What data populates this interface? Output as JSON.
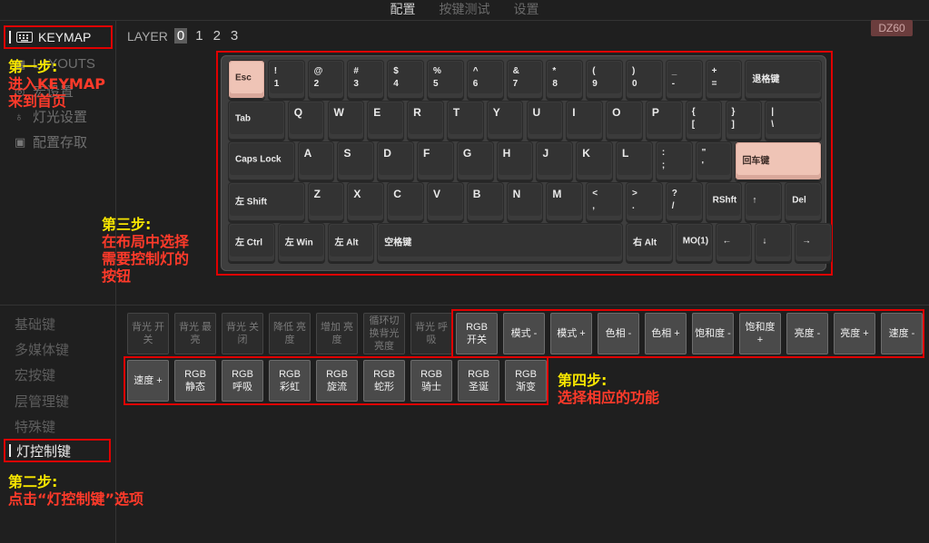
{
  "top_tabs": [
    "配置",
    "按键测试",
    "设置"
  ],
  "sidebar": {
    "keymap_label": "KEYMAP",
    "items": [
      {
        "label": "LAYOUTS",
        "icon": "layout-icon"
      },
      {
        "label": "宏设置",
        "icon": "macro-icon"
      },
      {
        "label": "灯光设置",
        "icon": "bulb-icon"
      },
      {
        "label": "配置存取",
        "icon": "save-icon"
      }
    ]
  },
  "layer": {
    "label": "LAYER",
    "values": [
      "0",
      "1",
      "2",
      "3"
    ],
    "selected": "0"
  },
  "badge": "DZ60",
  "annotations": {
    "step1_title": "第一步:",
    "step1_l1": "进入KEYMAP",
    "step1_l2": "来到首页",
    "step2_title": "第二步:",
    "step2_l1": "点击“灯控制键”选项",
    "step3_title": "第三步:",
    "step3_l1": "在布局中选择",
    "step3_l2": "需要控制灯的",
    "step3_l3": "按钮",
    "step4_title": "第四步:",
    "step4_l1": "选择相应的功能"
  },
  "keyboard": {
    "rows": [
      [
        {
          "c": "Esc",
          "pink": true
        },
        {
          "t": "!",
          "b": "1"
        },
        {
          "t": "@",
          "b": "2"
        },
        {
          "t": "#",
          "b": "3"
        },
        {
          "t": "$",
          "b": "4"
        },
        {
          "t": "%",
          "b": "5"
        },
        {
          "t": "^",
          "b": "6"
        },
        {
          "t": "&",
          "b": "7"
        },
        {
          "t": "*",
          "b": "8"
        },
        {
          "t": "(",
          "b": "9"
        },
        {
          "t": ")",
          "b": "0"
        },
        {
          "t": "_",
          "b": "-"
        },
        {
          "t": "+",
          "b": "="
        },
        {
          "c": "退格键"
        }
      ],
      [
        {
          "c": "Tab"
        },
        {
          "s": "Q"
        },
        {
          "s": "W"
        },
        {
          "s": "E"
        },
        {
          "s": "R"
        },
        {
          "s": "T"
        },
        {
          "s": "Y"
        },
        {
          "s": "U"
        },
        {
          "s": "I"
        },
        {
          "s": "O"
        },
        {
          "s": "P"
        },
        {
          "t": "{",
          "b": "["
        },
        {
          "t": "}",
          "b": "]"
        },
        {
          "t": "|",
          "b": "\\"
        }
      ],
      [
        {
          "c": "Caps Lock"
        },
        {
          "s": "A"
        },
        {
          "s": "S"
        },
        {
          "s": "D"
        },
        {
          "s": "F"
        },
        {
          "s": "G"
        },
        {
          "s": "H"
        },
        {
          "s": "J"
        },
        {
          "s": "K"
        },
        {
          "s": "L"
        },
        {
          "t": ":",
          "b": ";"
        },
        {
          "t": "\"",
          "b": "'"
        },
        {
          "c": "回车键",
          "pink": true
        }
      ],
      [
        {
          "c": "左 Shift"
        },
        {
          "s": "Z"
        },
        {
          "s": "X"
        },
        {
          "s": "C"
        },
        {
          "s": "V"
        },
        {
          "s": "B"
        },
        {
          "s": "N"
        },
        {
          "s": "M"
        },
        {
          "t": "<",
          "b": ","
        },
        {
          "t": ">",
          "b": "."
        },
        {
          "t": "?",
          "b": "/"
        },
        {
          "c": "RShft"
        },
        {
          "c": "↑"
        },
        {
          "c": "Del"
        }
      ],
      [
        {
          "c": "左 Ctrl"
        },
        {
          "c": "左 Win"
        },
        {
          "c": "左 Alt"
        },
        {
          "c": "空格键"
        },
        {
          "c": "右 Alt"
        },
        {
          "c": "MO(1)"
        },
        {
          "c": "←"
        },
        {
          "c": "↓"
        },
        {
          "c": "→"
        }
      ]
    ]
  },
  "categories": [
    "基础键",
    "多媒体键",
    "宏按键",
    "层管理键",
    "特殊键",
    "灯控制键"
  ],
  "light_keys_dim": [
    "背光 开关",
    "背光 最亮",
    "背光 关闭",
    "降低 亮度",
    "增加 亮度",
    "循环切换背光亮度",
    "背光 呼吸"
  ],
  "light_keys_row1": [
    "RGB\n开关",
    "模式 -",
    "模式 +",
    "色相 -",
    "色相 +",
    "饱和度 -",
    "饱和度\n+",
    "亮度 -",
    "亮度 +",
    "速度 -"
  ],
  "light_keys_row2": [
    "速度 +",
    "RGB\n静态",
    "RGB\n呼吸",
    "RGB\n彩虹",
    "RGB\n旋流",
    "RGB\n蛇形",
    "RGB\n骑士",
    "RGB\n圣诞",
    "RGB\n渐变"
  ]
}
